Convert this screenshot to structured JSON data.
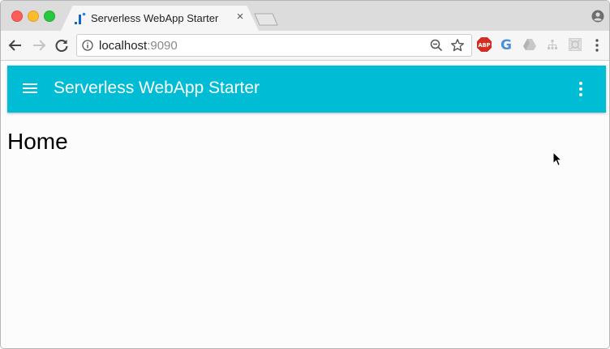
{
  "browser": {
    "tab": {
      "title": "Serverless WebApp Starter",
      "close_glyph": "×",
      "favicon": "app-logo-icon"
    },
    "address_bar": {
      "host": "localhost",
      "port": ":9090"
    },
    "extensions": [
      "adblock-plus-icon",
      "google-translate-icon",
      "google-drive-icon",
      "tree-icon",
      "box-icon"
    ]
  },
  "app": {
    "toolbar_title": "Serverless WebApp Starter",
    "accent_color": "#00bcd4",
    "heading": "Home"
  }
}
